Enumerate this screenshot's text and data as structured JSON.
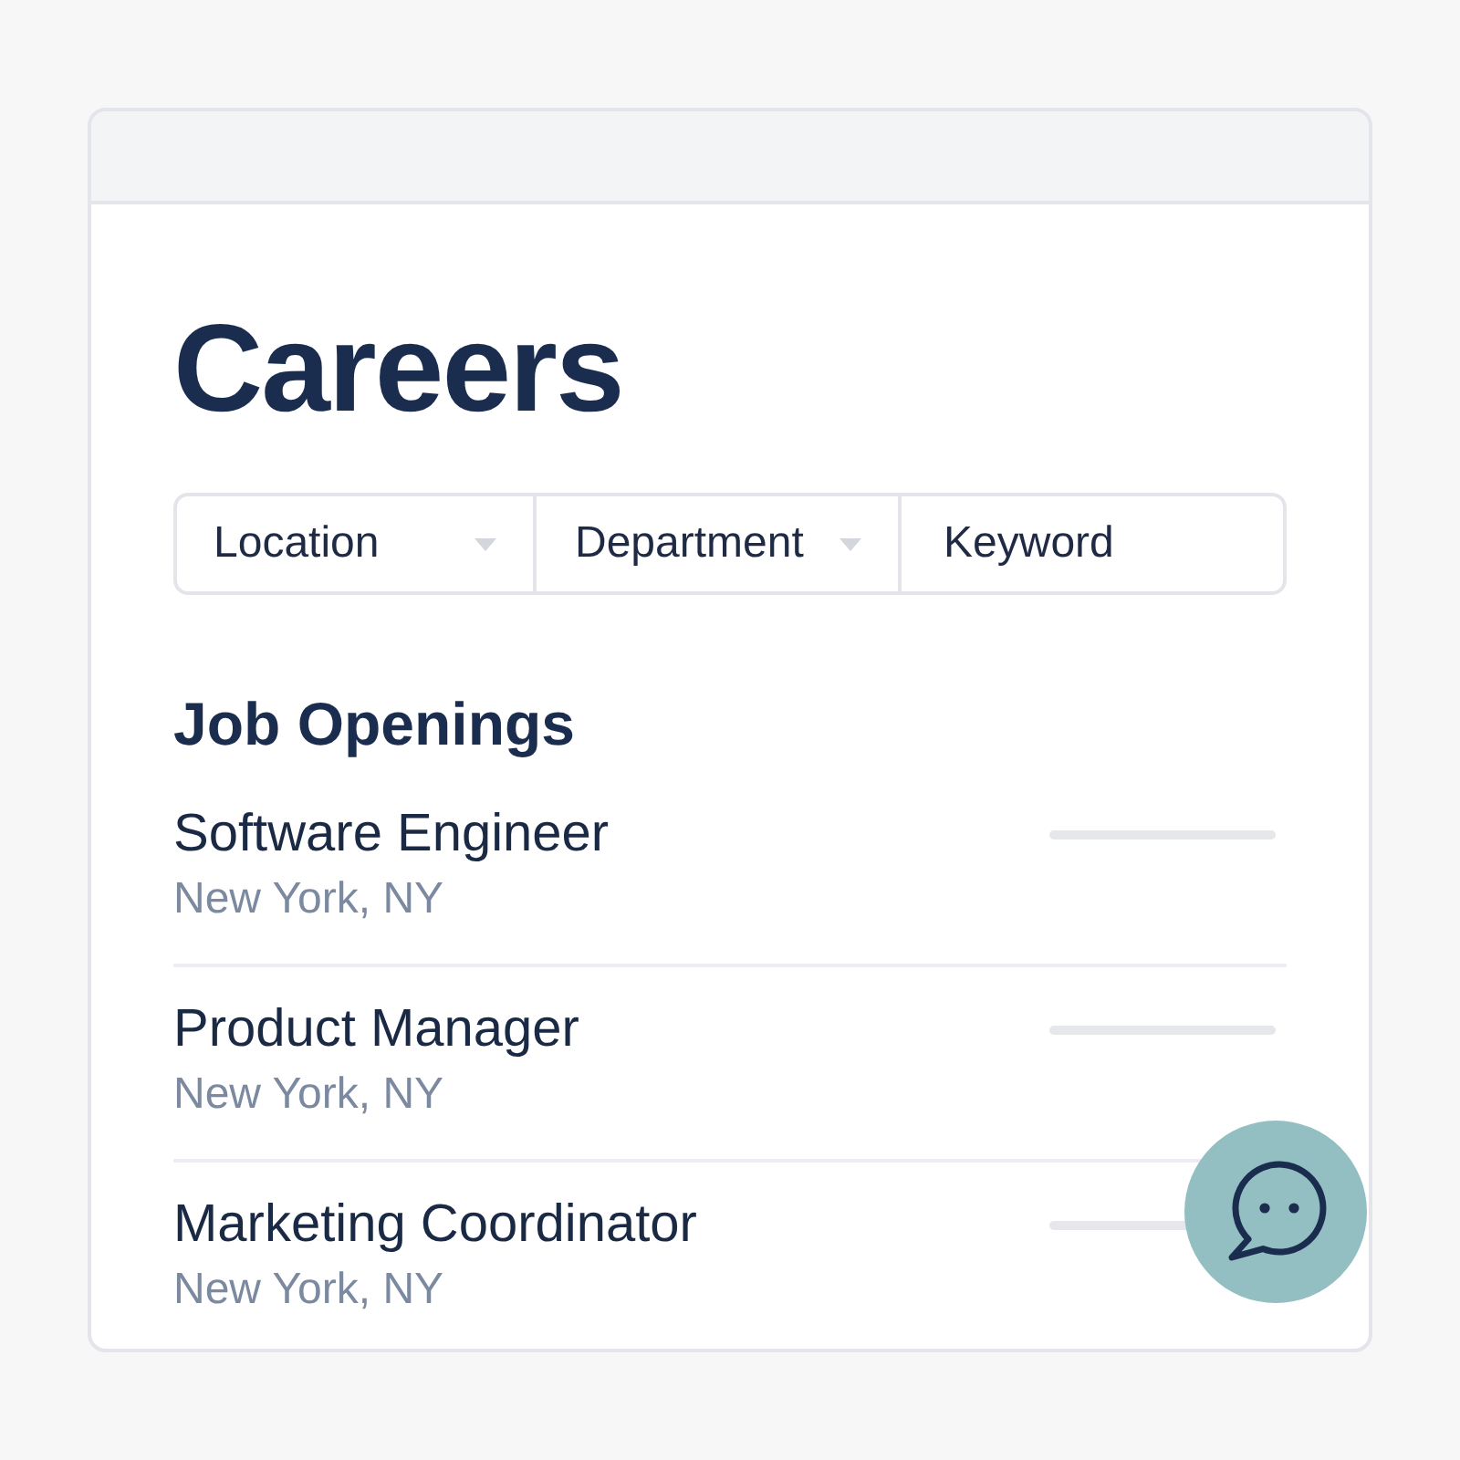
{
  "page_title": "Careers",
  "filters": [
    {
      "kind": "dropdown",
      "label": "Location"
    },
    {
      "kind": "dropdown",
      "label": "Department"
    },
    {
      "kind": "text",
      "placeholder": "Keyword"
    }
  ],
  "openings": {
    "heading": "Job Openings",
    "jobs": [
      {
        "title": "Software Engineer",
        "location": "New York, NY"
      },
      {
        "title": "Product Manager",
        "location": "New York, NY"
      },
      {
        "title": "Marketing Coordinator",
        "location": "New York, NY"
      }
    ]
  }
}
